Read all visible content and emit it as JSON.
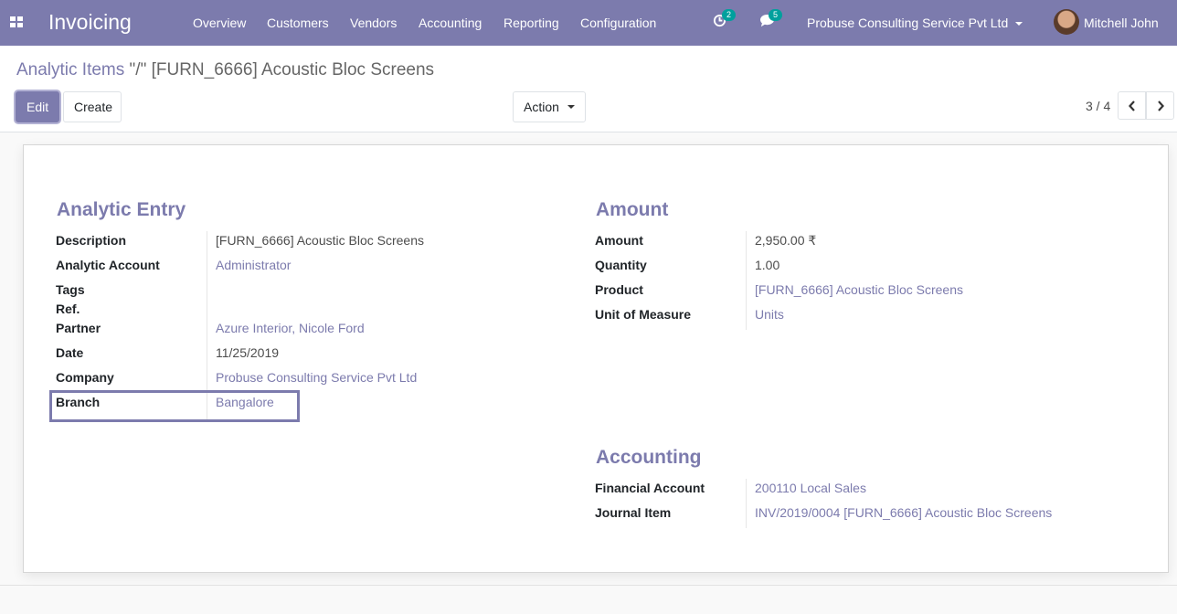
{
  "navbar": {
    "app_title": "Invoicing",
    "menu": [
      "Overview",
      "Customers",
      "Vendors",
      "Accounting",
      "Reporting",
      "Configuration"
    ],
    "activity_count": "2",
    "messages_count": "5",
    "company": "Probuse Consulting Service Pvt Ltd",
    "user": "Mitchell John",
    "accent_color": "#7c7bad"
  },
  "breadcrumb": {
    "parent": "Analytic Items",
    "separator": "\"/\"",
    "current": "[FURN_6666] Acoustic Bloc Screens"
  },
  "toolbar": {
    "edit_label": "Edit",
    "create_label": "Create",
    "action_label": "Action"
  },
  "pager": {
    "value": "3 / 4"
  },
  "form": {
    "analytic_entry": {
      "title": "Analytic Entry",
      "fields": {
        "description": {
          "label": "Description",
          "value": "[FURN_6666] Acoustic Bloc Screens"
        },
        "analytic_account": {
          "label": "Analytic Account",
          "value": "Administrator"
        },
        "tags": {
          "label": "Tags",
          "value": ""
        },
        "ref": {
          "label": "Ref.",
          "value": ""
        },
        "partner": {
          "label": "Partner",
          "value": "Azure Interior, Nicole Ford"
        },
        "date": {
          "label": "Date",
          "value": "11/25/2019"
        },
        "company": {
          "label": "Company",
          "value": "Probuse Consulting Service Pvt Ltd"
        },
        "branch": {
          "label": "Branch",
          "value": "Bangalore"
        }
      }
    },
    "amount": {
      "title": "Amount",
      "fields": {
        "amount": {
          "label": "Amount",
          "value": "2,950.00 ₹"
        },
        "quantity": {
          "label": "Quantity",
          "value": "1.00"
        },
        "product": {
          "label": "Product",
          "value": "[FURN_6666] Acoustic Bloc Screens"
        },
        "uom": {
          "label": "Unit of Measure",
          "value": "Units"
        }
      }
    },
    "accounting": {
      "title": "Accounting",
      "fields": {
        "financial_account": {
          "label": "Financial Account",
          "value": "200110 Local Sales"
        },
        "journal_item": {
          "label": "Journal Item",
          "value": "INV/2019/0004 [FURN_6666] Acoustic Bloc Screens"
        }
      }
    }
  }
}
